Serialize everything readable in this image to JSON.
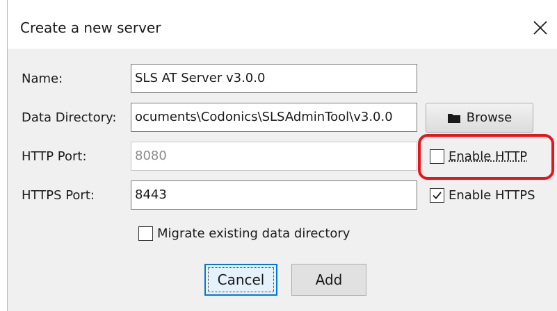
{
  "dialog": {
    "title": "Create a new server",
    "close_glyph": "✕"
  },
  "fields": {
    "name": {
      "label": "Name:",
      "value": "SLS AT Server v3.0.0"
    },
    "data_directory": {
      "label": "Data Directory:",
      "value": "ocuments\\Codonics\\SLSAdminTool\\v3.0.0"
    },
    "http_port": {
      "label": "HTTP Port:",
      "value": "8080",
      "enabled": false
    },
    "https_port": {
      "label": "HTTPS Port:",
      "value": "8443"
    }
  },
  "browse": {
    "label": "Browse",
    "icon": "folder-icon"
  },
  "checkboxes": {
    "enable_http": {
      "label": "Enable HTTP",
      "checked": false
    },
    "enable_https": {
      "label": "Enable HTTPS",
      "checked": true
    },
    "migrate": {
      "label": "Migrate existing data directory",
      "checked": false
    }
  },
  "buttons": {
    "cancel": "Cancel",
    "add": "Add"
  },
  "colors": {
    "highlight": "#e8131b",
    "default_button_border": "#0078d7",
    "dialog_background": "#f0f0f0"
  }
}
